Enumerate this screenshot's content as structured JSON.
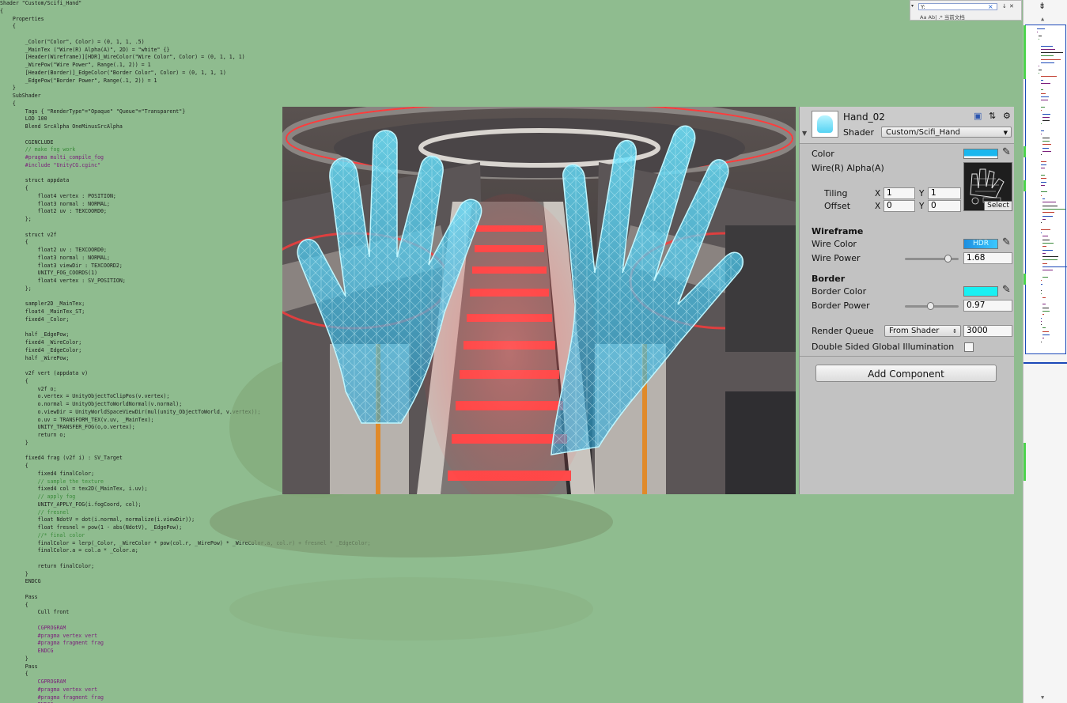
{
  "code_lines": [
    {
      "t": "Shader \"Custom/Scifi_Hand\""
    },
    {
      "t": "{"
    },
    {
      "t": "    Properties"
    },
    {
      "t": "    {"
    },
    {
      "t": ""
    },
    {
      "t": "        _Color(\"Color\", Color) = (0, 1, 1, .5)"
    },
    {
      "t": "        _MainTex (\"Wire(R) Alpha(A)\", 2D) = \"white\" {}"
    },
    {
      "t": "        [Header(Wireframe)][HDR]_WireColor(\"Wire Color\", Color) = (0, 1, 1, 1)"
    },
    {
      "t": "        _WirePow(\"Wire Power\", Range(.1, 2)) = 1"
    },
    {
      "t": "        [Header(Border)]_EdgeColor(\"Border Color\", Color) = (0, 1, 1, 1)"
    },
    {
      "t": "        _EdgePow(\"Border Power\", Range(.1, 2)) = 1"
    },
    {
      "t": "    }"
    },
    {
      "t": "    SubShader"
    },
    {
      "t": "    {"
    },
    {
      "t": "        Tags { \"RenderType\"=\"Opaque\" \"Queue\"=\"Transparent\"}"
    },
    {
      "t": "        LOD 100"
    },
    {
      "t": "        Blend SrcAlpha OneMinusSrcAlpha"
    },
    {
      "t": ""
    },
    {
      "t": "        CGINCLUDE"
    },
    {
      "t": "        // make fog work",
      "c": "#3a8a3a"
    },
    {
      "t": "        #pragma multi_compile_fog",
      "c": "#7a1d7a"
    },
    {
      "t": "        #include \"UnityCG.cginc\"",
      "c": "#7a1d7a"
    },
    {
      "t": ""
    },
    {
      "t": "        struct appdata"
    },
    {
      "t": "        {"
    },
    {
      "t": "            float4 vertex : POSITION;"
    },
    {
      "t": "            float3 normal : NORMAL;"
    },
    {
      "t": "            float2 uv : TEXCOORD0;"
    },
    {
      "t": "        };"
    },
    {
      "t": ""
    },
    {
      "t": "        struct v2f"
    },
    {
      "t": "        {"
    },
    {
      "t": "            float2 uv : TEXCOORD0;"
    },
    {
      "t": "            float3 normal : NORMAL;"
    },
    {
      "t": "            float3 viewDir : TEXCOORD2;"
    },
    {
      "t": "            UNITY_FOG_COORDS(1)"
    },
    {
      "t": "            float4 vertex : SV_POSITION;"
    },
    {
      "t": "        };"
    },
    {
      "t": ""
    },
    {
      "t": "        sampler2D _MainTex;"
    },
    {
      "t": "        float4 _MainTex_ST;"
    },
    {
      "t": "        fixed4 _Color;"
    },
    {
      "t": ""
    },
    {
      "t": "        half _EdgePow;"
    },
    {
      "t": "        fixed4 _WireColor;"
    },
    {
      "t": "        fixed4 _EdgeColor;"
    },
    {
      "t": "        half _WirePow;"
    },
    {
      "t": ""
    },
    {
      "t": "        v2f vert (appdata v)"
    },
    {
      "t": "        {"
    },
    {
      "t": "            v2f o;"
    },
    {
      "t": "            o.vertex = UnityObjectToClipPos(v.vertex);"
    },
    {
      "t": "            o.normal = UnityObjectToWorldNormal(v.normal);"
    },
    {
      "t": "            o.viewDir = UnityWorldSpaceViewDir(mul(unity_ObjectToWorld, v.vertex));"
    },
    {
      "t": "            o.uv = TRANSFORM_TEX(v.uv, _MainTex);"
    },
    {
      "t": "            UNITY_TRANSFER_FOG(o,o.vertex);"
    },
    {
      "t": "            return o;"
    },
    {
      "t": "        }"
    },
    {
      "t": ""
    },
    {
      "t": "        fixed4 frag (v2f i) : SV_Target"
    },
    {
      "t": "        {"
    },
    {
      "t": "            fixed4 finalColor;"
    },
    {
      "t": "            // sample the texture",
      "c": "#3a8a3a"
    },
    {
      "t": "            fixed4 col = tex2D(_MainTex, i.uv);"
    },
    {
      "t": "            // apply fog",
      "c": "#3a8a3a"
    },
    {
      "t": "            UNITY_APPLY_FOG(i.fogCoord, col);"
    },
    {
      "t": "            // fresnel",
      "c": "#3a8a3a"
    },
    {
      "t": "            float NdotV = dot(i.normal, normalize(i.viewDir));"
    },
    {
      "t": "            float fresnel = pow(1 - abs(NdotV), _EdgePow);"
    },
    {
      "t": "            //* final color",
      "c": "#3a8a3a"
    },
    {
      "t": "            finalColor = lerp(_Color, _WireColor * pow(col.r, _WirePow) * _WireColor.a, col.r) + fresnel * _EdgeColor;"
    },
    {
      "t": "            finalColor.a = col.a * _Color.a;"
    },
    {
      "t": ""
    },
    {
      "t": "            return finalColor;"
    },
    {
      "t": "        }"
    },
    {
      "t": "        ENDCG"
    },
    {
      "t": ""
    },
    {
      "t": "        Pass"
    },
    {
      "t": "        {"
    },
    {
      "t": "            Cull front"
    },
    {
      "t": ""
    },
    {
      "t": "            CGPROGRAM",
      "c": "#7a1d7a"
    },
    {
      "t": "            #pragma vertex vert",
      "c": "#7a1d7a"
    },
    {
      "t": "            #pragma fragment frag",
      "c": "#7a1d7a"
    },
    {
      "t": "            ENDCG",
      "c": "#7a1d7a"
    },
    {
      "t": "        }"
    },
    {
      "t": "        Pass"
    },
    {
      "t": "        {"
    },
    {
      "t": "            CGPROGRAM",
      "c": "#7a1d7a"
    },
    {
      "t": "            #pragma vertex vert",
      "c": "#7a1d7a"
    },
    {
      "t": "            #pragma fragment frag",
      "c": "#7a1d7a"
    },
    {
      "t": "            ENDCG",
      "c": "#7a1d7a"
    },
    {
      "t": "        }"
    }
  ],
  "find": {
    "value": "Y:",
    "clear_glyph": "×",
    "options": "Aa  Ab|  .*  当前文档"
  },
  "inspector": {
    "material_name": "Hand_02",
    "shader_label": "Shader",
    "shader_value": "Custom/Scifi_Hand",
    "color_label": "Color",
    "color_swatch": "#1ab7ee",
    "tex_label": "Wire(R) Alpha(A)",
    "tiling_label": "Tiling",
    "offset_label": "Offset",
    "x_label": "X",
    "y_label": "Y",
    "tiling_x": "1",
    "tiling_y": "1",
    "offset_x": "0",
    "offset_y": "0",
    "select_label": "Select",
    "wireframe_header": "Wireframe",
    "wire_color_label": "Wire Color",
    "hdr_label": "HDR",
    "wire_power_label": "Wire Power",
    "wire_power_value": "1.68",
    "border_header": "Border",
    "border_color_label": "Border Color",
    "border_color_swatch": "#19f0f2",
    "border_power_label": "Border Power",
    "border_power_value": "0.97",
    "render_queue_label": "Render Queue",
    "render_queue_mode": "From Shader",
    "render_queue_value": "3000",
    "dsgi_label": "Double Sided Global Illumination",
    "add_component_label": "Add Component"
  },
  "colors": {
    "background": "#8fbc8f",
    "hand_glow": "#4fd8ff",
    "step_light": "#ff3a3a"
  }
}
